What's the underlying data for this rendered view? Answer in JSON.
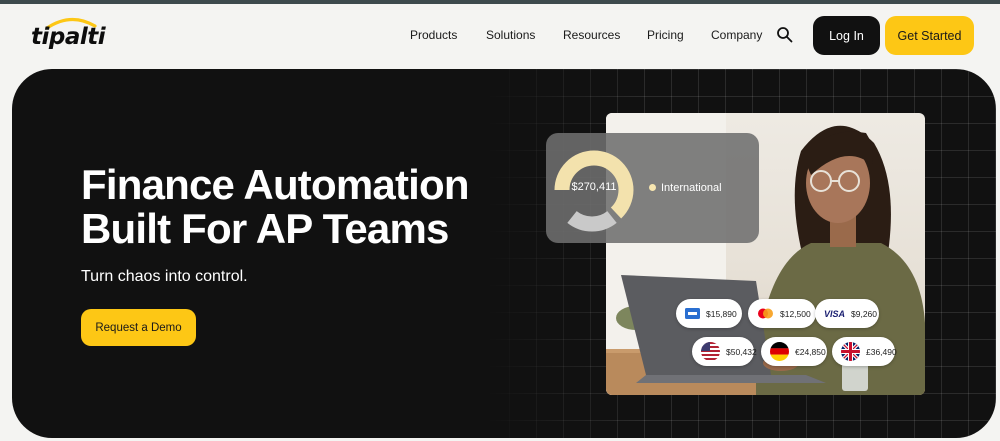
{
  "brand": {
    "logo_text": "tipalti"
  },
  "nav": {
    "items": [
      "Products",
      "Solutions",
      "Resources",
      "Pricing",
      "Company"
    ],
    "login_label": "Log In",
    "get_started_label": "Get Started"
  },
  "hero": {
    "title_line1": "Finance Automation",
    "title_line2": "Built For AP Teams",
    "subtitle": "Turn chaos into control.",
    "cta_label": "Request a Demo"
  },
  "donut": {
    "value": "$270,411",
    "legend": "International",
    "segments": [
      {
        "name": "International",
        "color": "#f3e2ad",
        "fraction": 0.55
      },
      {
        "name": "other",
        "color": "#cfcfcf",
        "fraction": 0.45
      }
    ]
  },
  "payments": {
    "cards": [
      {
        "icon": "amex-icon",
        "amount": "$15,890"
      },
      {
        "icon": "mastercard-icon",
        "amount": "$12,500"
      },
      {
        "icon": "visa-icon",
        "amount": "$9,260",
        "icon_text": "VISA"
      }
    ],
    "currencies": [
      {
        "icon": "us-flag-icon",
        "amount": "$50,432"
      },
      {
        "icon": "germany-flag-icon",
        "amount": "€24,850"
      },
      {
        "icon": "uk-flag-icon",
        "amount": "£36,490"
      }
    ]
  },
  "colors": {
    "accent": "#fdc715",
    "dark": "#111111",
    "header_bg": "#f4f4f2"
  }
}
